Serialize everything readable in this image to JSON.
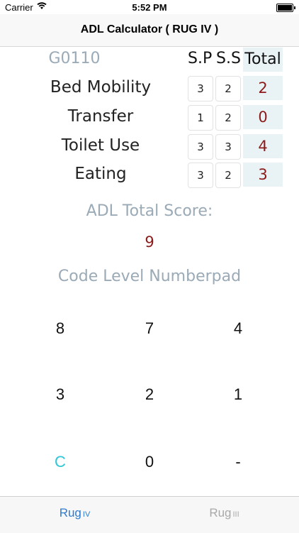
{
  "status_bar": {
    "carrier": "Carrier",
    "time": "5:52 PM"
  },
  "nav": {
    "title": "ADL Calculator ( RUG IV )"
  },
  "table": {
    "code_header": "G0110",
    "col_sp": "S.P",
    "col_ss": "S.S",
    "col_total": "Total",
    "rows": [
      {
        "label": "Bed Mobility",
        "sp": "3",
        "ss": "2",
        "total": "2"
      },
      {
        "label": "Transfer",
        "sp": "1",
        "ss": "2",
        "total": "0"
      },
      {
        "label": "Toilet Use",
        "sp": "3",
        "ss": "3",
        "total": "4"
      },
      {
        "label": "Eating",
        "sp": "3",
        "ss": "2",
        "total": "3"
      }
    ]
  },
  "adl": {
    "label": "ADL Total Score:",
    "score": "9"
  },
  "numberpad": {
    "label": "Code Level Numberpad",
    "keys": [
      "8",
      "7",
      "4",
      "3",
      "2",
      "1",
      "C",
      "0",
      "-"
    ]
  },
  "tabs": [
    {
      "main": "Rug",
      "sub": "IV",
      "active": true
    },
    {
      "main": "Rug",
      "sub": "III",
      "active": false
    }
  ],
  "colors": {
    "accent": "#2f7bd0",
    "total_text": "#8b1a1a",
    "total_bg": "#e9f3f5",
    "muted_label": "#9aaab6",
    "clear_key": "#2fc6d6"
  },
  "icons": [
    "wifi-icon",
    "battery-icon"
  ]
}
